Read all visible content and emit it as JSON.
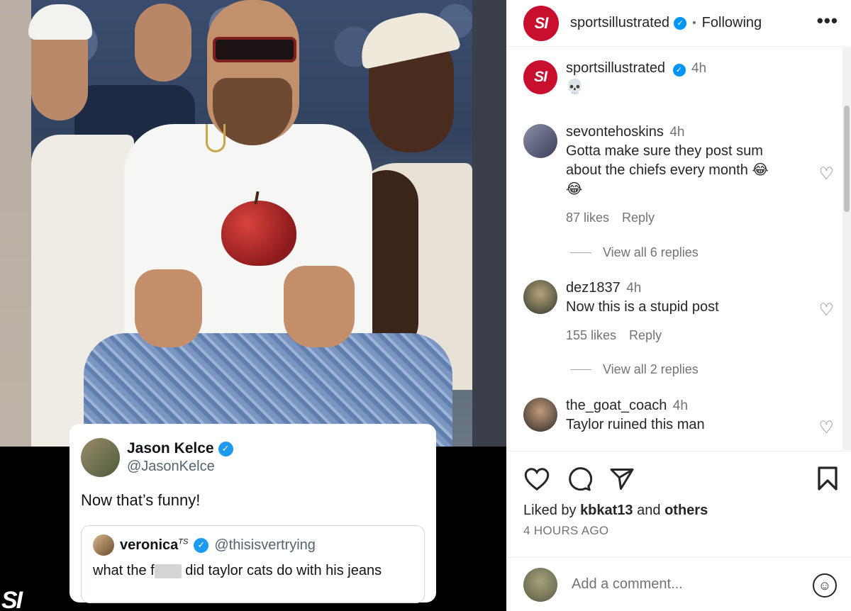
{
  "post": {
    "username": "sportsillustrated",
    "follow_status": "Following",
    "logo_text": "SI",
    "more_label": "•••",
    "caption_time": "4h",
    "caption_text": "💀",
    "watermark": "SI"
  },
  "tweet": {
    "name": "Jason Kelce",
    "handle": "@JasonKelce",
    "text": "Now that’s funny!",
    "quote": {
      "name": "veronica",
      "name_suffix": "TS",
      "handle": "@thisisvertrying",
      "text_before": "what the f",
      "text_after": "did taylor cats do with his jeans"
    }
  },
  "comments": [
    {
      "user": "sevontehoskins",
      "time": "4h",
      "text_line1": "Gotta make sure they post sum",
      "text_line2": "about the chiefs every month 😂",
      "text_line3": "😂",
      "likes": "87 likes",
      "reply": "Reply",
      "view_replies": "View all 6 replies"
    },
    {
      "user": "dez1837",
      "time": "4h",
      "text": "Now this is a stupid post",
      "likes": "155 likes",
      "reply": "Reply",
      "view_replies": "View all 2 replies"
    },
    {
      "user": "the_goat_coach",
      "time": "4h",
      "text": "Taylor ruined this man"
    }
  ],
  "actions": {
    "liked_prefix": "Liked by",
    "liked_user": "kbkat13",
    "liked_and": "and",
    "liked_others": "others",
    "time_ago": "4 HOURS AGO"
  },
  "add_comment": {
    "placeholder": "Add a comment..."
  },
  "colors": {
    "brand_red": "#c8102e",
    "verified_blue": "#0095f6",
    "twitter_blue": "#1d9bf0"
  }
}
